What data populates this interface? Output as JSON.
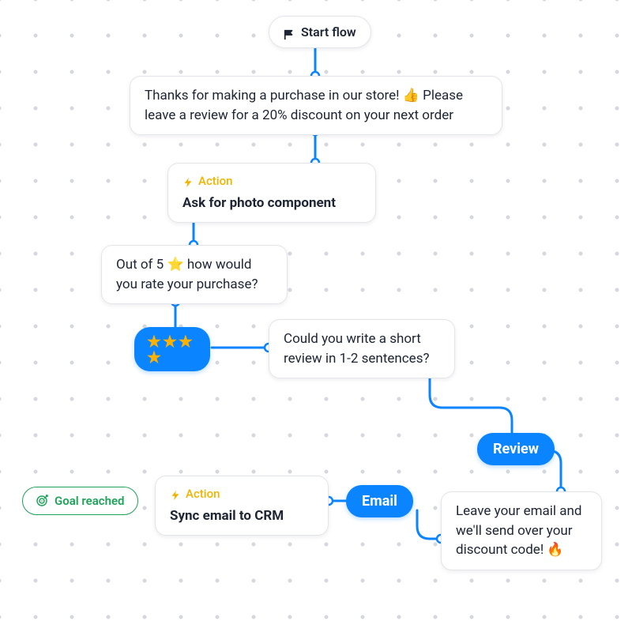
{
  "start": {
    "label": "Start flow"
  },
  "nodes": {
    "thanks": "Thanks for making a purchase in our store! 👍 Please leave a review for a 20% discount on your next order",
    "action_photo": {
      "tag": "Action",
      "title": "Ask for photo component"
    },
    "rate": "Out of 5 ⭐ how would you rate your purchase?",
    "stars_chip": "★★★★",
    "review_ask": "Could you write a short review in 1-2 sentences?",
    "review_chip": "Review",
    "email_ask": "Leave your email and we'll send over your discount code! 🔥",
    "email_chip": "Email",
    "action_crm": {
      "tag": "Action",
      "title": "Sync email to CRM"
    },
    "goal": "Goal reached"
  }
}
